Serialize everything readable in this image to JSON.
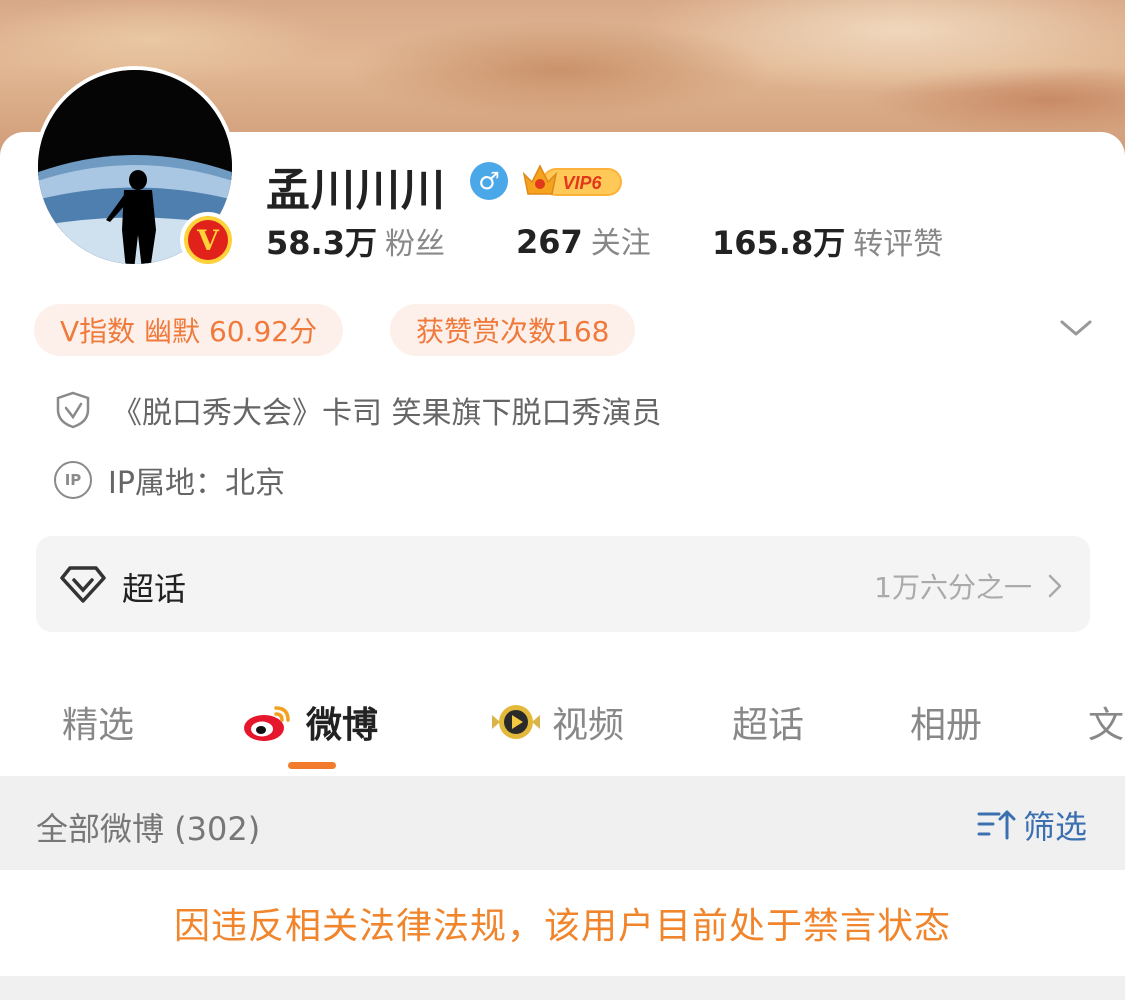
{
  "profile": {
    "name": "孟川川川",
    "vip_label": "VIP6",
    "stats": [
      {
        "value": "58.3万",
        "label": "粉丝"
      },
      {
        "value": "267",
        "label": "关注"
      },
      {
        "value": "165.8万",
        "label": "转评赞"
      }
    ]
  },
  "tags": {
    "v_index": "V指数 幽默 60.92分",
    "rewards": "获赞赏次数168"
  },
  "info": {
    "verification": "《脱口秀大会》卡司  笑果旗下脱口秀演员",
    "ip_icon_text": "IP",
    "ip_location": "IP属地：北京"
  },
  "chaohua": {
    "label": "超话",
    "right_text": "1万六分之一"
  },
  "tabs": [
    {
      "label": "精选",
      "active": false
    },
    {
      "label": "微博",
      "active": true
    },
    {
      "label": "视频",
      "active": false
    },
    {
      "label": "超话",
      "active": false
    },
    {
      "label": "相册",
      "active": false
    },
    {
      "label": "文",
      "active": false
    }
  ],
  "feed": {
    "all_posts": "全部微博 (302)",
    "filter_label": "筛选",
    "notice": "因违反相关法律法规，该用户目前处于禁言状态"
  },
  "colors": {
    "accent_orange": "#f37b2e",
    "notice_orange": "#f0852c",
    "filter_blue": "#3b6fb0",
    "verified_red": "#e0221a",
    "gender_blue": "#4aa8e8"
  },
  "icons": [
    "v-verified-icon",
    "male-icon",
    "vip-crown-icon",
    "chevron-down-icon",
    "shield-check-icon",
    "ip-icon",
    "chaohua-diamond-icon",
    "chevron-right-icon",
    "weibo-logo-icon",
    "video-play-icon",
    "filter-sort-icon"
  ]
}
